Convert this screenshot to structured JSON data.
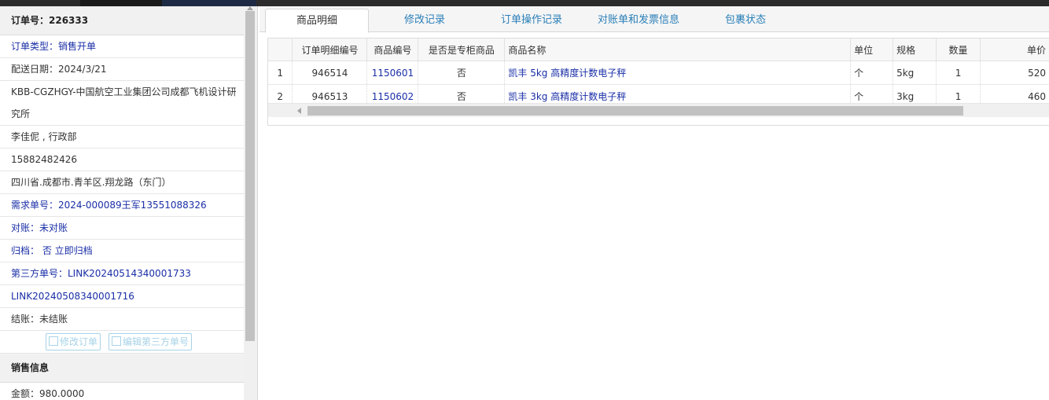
{
  "colors": {
    "link": "#1a2ea6",
    "tab_link": "#2a7fb8",
    "button_disabled": "#a7d2e7",
    "topbar": "#2b2b2b"
  },
  "order": {
    "header": "订单号：226333",
    "type": "订单类型：销售开单",
    "date": "配送日期：2024/3/21",
    "company": "KBB-CGZHGY-中国航空工业集团公司成都飞机设计研究所",
    "contact": "李佳伲 , 行政部",
    "phone": "15882482426",
    "address": "四川省.成都市.青羊区.翔龙路（东门）",
    "demand_no": "需求单号：2024-000089王军13551088326",
    "reconcile": "对账：未对账",
    "archive": "归档：  否 立即归档",
    "third_party_no_1": "第三方单号：LINK20240514340001733",
    "third_party_no_2": "LINK20240508340001716",
    "settle": "结账：未结账",
    "btn_edit_order": "修改订单",
    "btn_edit_third": "编辑第三方单号",
    "sales_header": "销售信息",
    "amount": "金额：980.0000"
  },
  "tabs": [
    "商品明细",
    "修改记录",
    "订单操作记录",
    "对账单和发票信息",
    "包裹状态"
  ],
  "table": {
    "headers": [
      "",
      "订单明细编号",
      "商品编号",
      "是否是专柜商品",
      "商品名称",
      "单位",
      "规格",
      "数量",
      "单价"
    ],
    "rows": [
      [
        "1",
        "946514",
        "1150601",
        "否",
        "凯丰 5kg 高精度计数电子秤",
        "个",
        "5kg",
        "1",
        "520"
      ],
      [
        "2",
        "946513",
        "1150602",
        "否",
        "凯丰 3kg 高精度计数电子秤",
        "个",
        "3kg",
        "1",
        "460"
      ]
    ]
  }
}
